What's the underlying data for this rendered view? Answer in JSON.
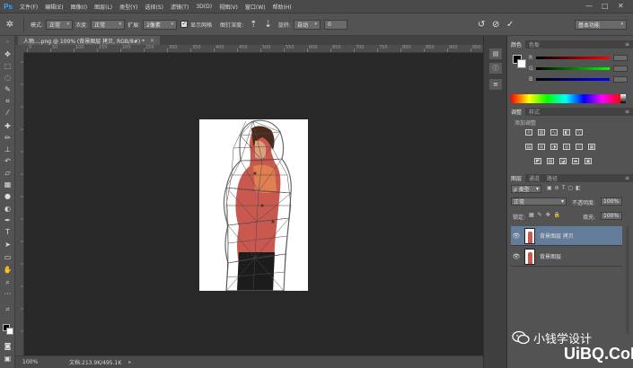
{
  "app": {
    "logo": "Ps",
    "menu": [
      "文件(F)",
      "编辑(E)",
      "图像(I)",
      "图层(L)",
      "类型(Y)",
      "选择(S)",
      "滤镜(T)",
      "3D(D)",
      "视图(V)",
      "窗口(W)",
      "帮助(H)"
    ],
    "window_controls": [
      "—",
      "□",
      "✕"
    ]
  },
  "options_bar": {
    "mode_label": "模式:",
    "mode_value": "正常",
    "density_label": "浓度:",
    "density_value": "正常",
    "expansion_label": "扩展:",
    "expansion_value": "2像素",
    "show_mesh_label": "显示网格",
    "pin_depth_label": "图钉深度:",
    "rotate_label": "旋转:",
    "rotate_value": "自动",
    "rotate_degrees": "0",
    "workspace": "基本功能"
  },
  "document": {
    "tab_title": "人物....png @ 100% (背景图层 拷贝, RGB/8#) *",
    "tab_close": "×"
  },
  "ruler": {
    "h_ticks": [
      "0",
      "50",
      "100",
      "150",
      "200",
      "250",
      "300",
      "350",
      "400",
      "450",
      "500",
      "550",
      "600",
      "650",
      "700",
      "750",
      "800",
      "850",
      "900",
      "950"
    ]
  },
  "status": {
    "zoom": "100%",
    "doc_info": "文档:213.9K/495.1K",
    "arrow": "▸"
  },
  "panels": {
    "color_tabs": [
      "颜色",
      "色板"
    ],
    "color_rows": [
      "R",
      "G",
      "B"
    ],
    "adjust_tabs": [
      "调整",
      "样式"
    ],
    "adjust_title": "添加调整",
    "layers_tabs": [
      "图层",
      "通道",
      "路径"
    ],
    "kind_label": "ρ 类型",
    "blend_mode": "正常",
    "opacity_label": "不透明度:",
    "opacity_value": "100%",
    "lock_label": "锁定:",
    "fill_label": "填充:",
    "fill_value": "100%",
    "layers": [
      {
        "name": "背景图层 拷贝",
        "selected": true
      },
      {
        "name": "背景图层",
        "selected": false
      }
    ]
  },
  "watermark": {
    "text": "小钱学设计",
    "url": "UiBQ.CoM"
  },
  "colors": {
    "accent_selected_layer": "#637c99",
    "canvas_bg": "#282828",
    "panel_bg": "#535353",
    "ps_blue": "#31a8ff"
  }
}
